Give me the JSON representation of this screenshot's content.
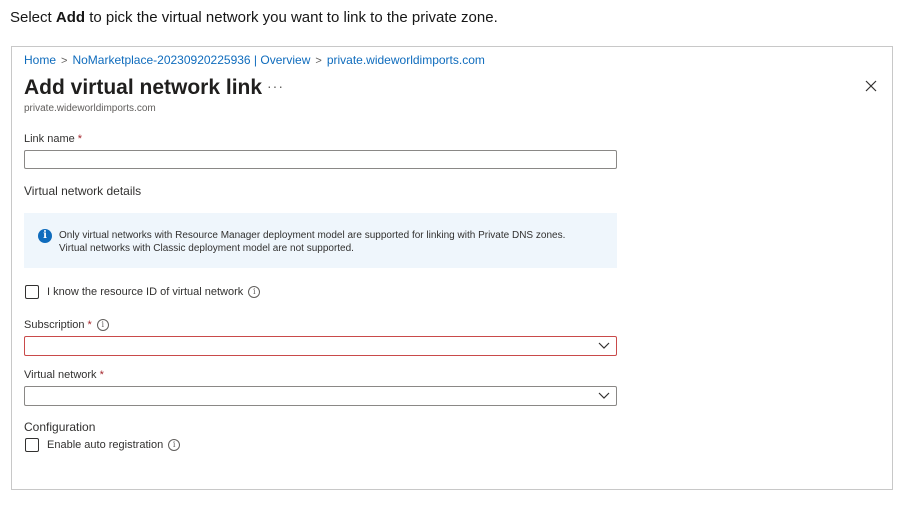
{
  "caption": {
    "prefix": "Select ",
    "bold": "Add",
    "suffix": " to pick the virtual network you want to link to the private zone."
  },
  "breadcrumb": {
    "items": [
      "Home",
      "NoMarketplace-20230920225936 | Overview",
      "private.wideworldimports.com"
    ],
    "separator": ">"
  },
  "header": {
    "title": "Add virtual network link",
    "more_label": "···",
    "close_label": "✕",
    "subtitle": "private.wideworldimports.com"
  },
  "form": {
    "link_name": {
      "label": "Link name",
      "required_mark": "*",
      "value": ""
    },
    "vnet_details_heading": "Virtual network details",
    "info": {
      "icon_glyph": "i",
      "line1": "Only virtual networks with Resource Manager deployment model are supported for linking with Private DNS zones.",
      "line2": "Virtual networks with Classic deployment model are not supported."
    },
    "know_resource_id": {
      "label": "I know the resource ID of virtual network",
      "checked": false
    },
    "subscription": {
      "label": "Subscription",
      "required_mark": "*",
      "value": "",
      "state": "error"
    },
    "virtual_network": {
      "label": "Virtual network",
      "required_mark": "*",
      "value": ""
    },
    "configuration_heading": "Configuration",
    "auto_registration": {
      "label": "Enable auto registration",
      "checked": false
    }
  },
  "colors": {
    "link": "#0f6cbd",
    "required": "#a4262c",
    "error_border": "#c94a4a",
    "info_bg": "#eff6fc"
  }
}
